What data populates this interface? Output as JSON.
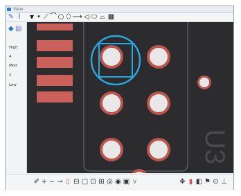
{
  "window": {
    "title": "View"
  },
  "toolbar": {
    "tools": [
      {
        "name": "pencil-icon",
        "glyph": "✎"
      },
      {
        "name": "brush-icon",
        "glyph": "⌇"
      },
      {
        "name": "filter-icon",
        "glyph": "▼"
      },
      {
        "name": "dot-icon",
        "glyph": "•"
      },
      {
        "name": "line-icon",
        "glyph": "⟋"
      },
      {
        "name": "arc-icon",
        "glyph": "⌒"
      },
      {
        "name": "circle-icon",
        "glyph": "○"
      },
      {
        "name": "ellipse-icon",
        "glyph": "⬯"
      },
      {
        "name": "arrow-icon",
        "glyph": "⟶"
      },
      {
        "name": "triangle-icon",
        "glyph": "◁"
      },
      {
        "name": "shape-icon",
        "glyph": "⬭"
      },
      {
        "name": "dome-icon",
        "glyph": "⌓"
      },
      {
        "name": "grid-icon",
        "glyph": "▦"
      }
    ]
  },
  "left_panel": {
    "levels": [
      "High",
      "4",
      "Med",
      "2",
      "Low"
    ]
  },
  "canvas": {
    "label": "U3",
    "colors": {
      "background": "#2c2c2e",
      "pad": "#c9605a",
      "ring": "#b9564f",
      "hole": "#e8e8e8",
      "select": "#28a8e0",
      "outline": "#5a5a5e"
    }
  },
  "bottom_toolbar": {
    "tools": [
      {
        "name": "pen-icon",
        "glyph": "✐"
      },
      {
        "name": "plus-icon",
        "glyph": "+"
      },
      {
        "name": "minus-icon",
        "glyph": "−"
      },
      {
        "name": "dash-icon",
        "glyph": "⊸"
      },
      {
        "name": "bars-icon",
        "glyph": "▯"
      },
      {
        "name": "box-minus-icon",
        "glyph": "⊟"
      },
      {
        "name": "box-icon",
        "glyph": "□"
      },
      {
        "name": "box-dot-icon",
        "glyph": "⊡"
      },
      {
        "name": "grid-plus-icon",
        "glyph": "⊞"
      },
      {
        "name": "target-icon",
        "glyph": "◎"
      },
      {
        "name": "ring-icon",
        "glyph": "◉"
      },
      {
        "name": "frame-icon",
        "glyph": "▣"
      },
      {
        "name": "chevron-icon",
        "glyph": "∨"
      },
      {
        "name": "move-icon",
        "glyph": "✥"
      },
      {
        "name": "film-icon",
        "glyph": "▮"
      },
      {
        "name": "layers-icon",
        "glyph": "◧"
      },
      {
        "name": "flag-icon",
        "glyph": "⚑"
      },
      {
        "name": "gauge-icon",
        "glyph": "⊙"
      },
      {
        "name": "bracket-icon",
        "glyph": "⊥"
      }
    ]
  }
}
